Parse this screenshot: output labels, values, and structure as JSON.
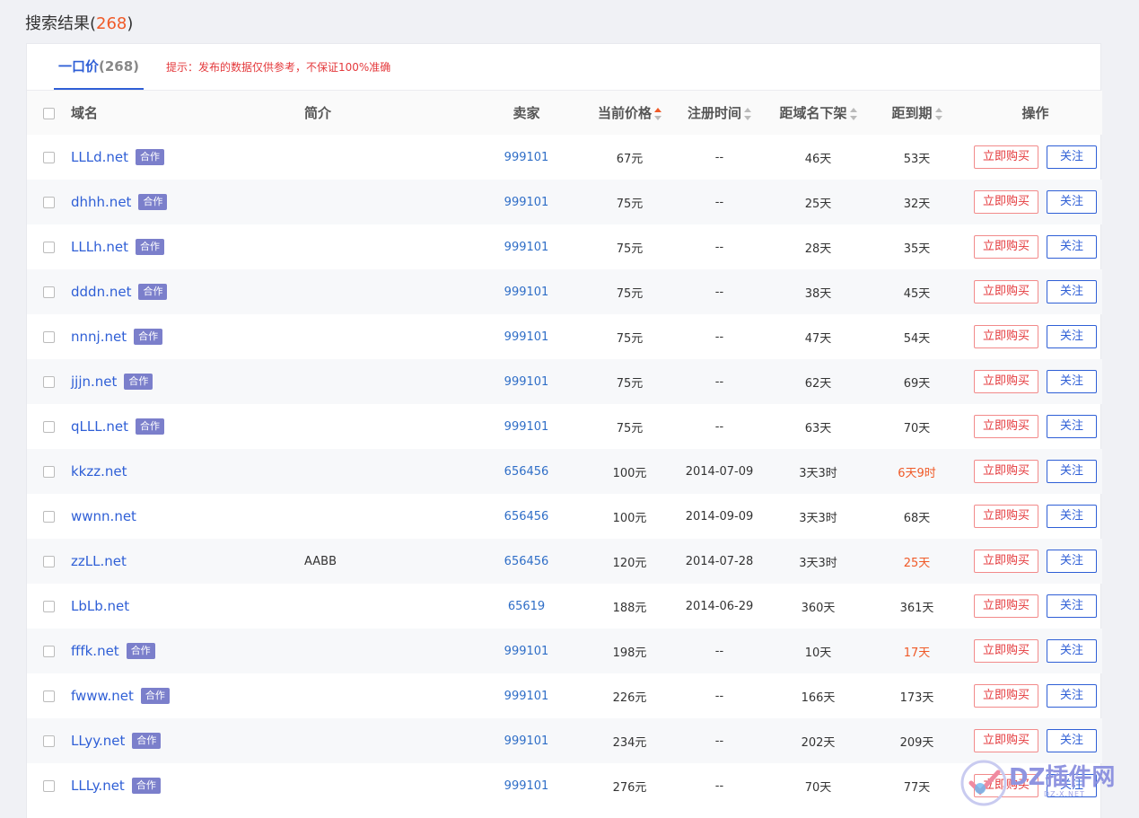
{
  "header": {
    "title": "搜索结果",
    "count": "268"
  },
  "tabs": [
    {
      "label": "一口价",
      "count": "(268)"
    }
  ],
  "hint": "提示：发布的数据仅供参考，不保证100%准确",
  "columns": {
    "domain": "域名",
    "intro": "简介",
    "seller": "卖家",
    "price": "当前价格",
    "reg_time": "注册时间",
    "delist": "距域名下架",
    "expire": "距到期",
    "action": "操作"
  },
  "badge_label": "合作",
  "buy_label": "立即购买",
  "follow_label": "关注",
  "colors": {
    "accent": "#2f5fd6",
    "alert": "#f05a28",
    "badge": "#7b7fcb"
  },
  "rows": [
    {
      "domain": "LLLd.net",
      "badge": true,
      "intro": "",
      "seller": "999101",
      "price": "67元",
      "reg_time": "--",
      "delist": "46天",
      "expire": "53天",
      "expire_alert": false
    },
    {
      "domain": "dhhh.net",
      "badge": true,
      "intro": "",
      "seller": "999101",
      "price": "75元",
      "reg_time": "--",
      "delist": "25天",
      "expire": "32天",
      "expire_alert": false
    },
    {
      "domain": "LLLh.net",
      "badge": true,
      "intro": "",
      "seller": "999101",
      "price": "75元",
      "reg_time": "--",
      "delist": "28天",
      "expire": "35天",
      "expire_alert": false
    },
    {
      "domain": "dddn.net",
      "badge": true,
      "intro": "",
      "seller": "999101",
      "price": "75元",
      "reg_time": "--",
      "delist": "38天",
      "expire": "45天",
      "expire_alert": false
    },
    {
      "domain": "nnnj.net",
      "badge": true,
      "intro": "",
      "seller": "999101",
      "price": "75元",
      "reg_time": "--",
      "delist": "47天",
      "expire": "54天",
      "expire_alert": false
    },
    {
      "domain": "jjjn.net",
      "badge": true,
      "intro": "",
      "seller": "999101",
      "price": "75元",
      "reg_time": "--",
      "delist": "62天",
      "expire": "69天",
      "expire_alert": false
    },
    {
      "domain": "qLLL.net",
      "badge": true,
      "intro": "",
      "seller": "999101",
      "price": "75元",
      "reg_time": "--",
      "delist": "63天",
      "expire": "70天",
      "expire_alert": false
    },
    {
      "domain": "kkzz.net",
      "badge": false,
      "intro": "",
      "seller": "656456",
      "price": "100元",
      "reg_time": "2014-07-09",
      "delist": "3天3时",
      "expire": "6天9时",
      "expire_alert": true
    },
    {
      "domain": "wwnn.net",
      "badge": false,
      "intro": "",
      "seller": "656456",
      "price": "100元",
      "reg_time": "2014-09-09",
      "delist": "3天3时",
      "expire": "68天",
      "expire_alert": false
    },
    {
      "domain": "zzLL.net",
      "badge": false,
      "intro": "AABB",
      "seller": "656456",
      "price": "120元",
      "reg_time": "2014-07-28",
      "delist": "3天3时",
      "expire": "25天",
      "expire_alert": true
    },
    {
      "domain": "LbLb.net",
      "badge": false,
      "intro": "",
      "seller": "65619",
      "price": "188元",
      "reg_time": "2014-06-29",
      "delist": "360天",
      "expire": "361天",
      "expire_alert": false
    },
    {
      "domain": "fffk.net",
      "badge": true,
      "intro": "",
      "seller": "999101",
      "price": "198元",
      "reg_time": "--",
      "delist": "10天",
      "expire": "17天",
      "expire_alert": true
    },
    {
      "domain": "fwww.net",
      "badge": true,
      "intro": "",
      "seller": "999101",
      "price": "226元",
      "reg_time": "--",
      "delist": "166天",
      "expire": "173天",
      "expire_alert": false
    },
    {
      "domain": "LLyy.net",
      "badge": true,
      "intro": "",
      "seller": "999101",
      "price": "234元",
      "reg_time": "--",
      "delist": "202天",
      "expire": "209天",
      "expire_alert": false
    },
    {
      "domain": "LLLy.net",
      "badge": true,
      "intro": "",
      "seller": "999101",
      "price": "276元",
      "reg_time": "--",
      "delist": "70天",
      "expire": "77天",
      "expire_alert": false
    }
  ],
  "watermark": {
    "text": "DZ插件网",
    "sub": "DZ-X.NET"
  }
}
